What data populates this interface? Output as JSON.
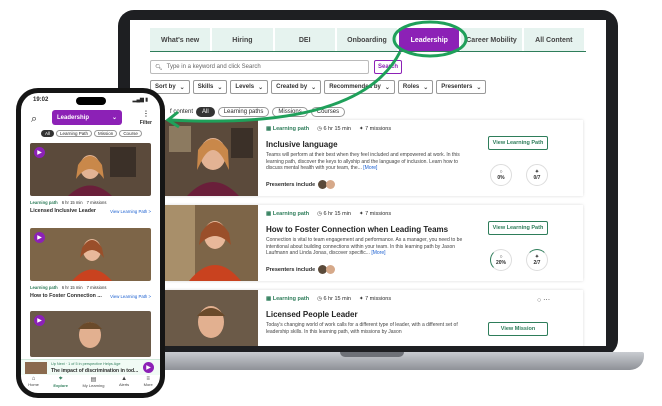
{
  "desktop": {
    "tabs": [
      {
        "label": "What's new"
      },
      {
        "label": "Hiring"
      },
      {
        "label": "DEI"
      },
      {
        "label": "Onboarding"
      },
      {
        "label": "Leadership"
      },
      {
        "label": "Career Mobility"
      },
      {
        "label": "All Content"
      }
    ],
    "search_placeholder": "Type in a keyword and click Search",
    "search_button": "Search",
    "filters": [
      "Sort by",
      "Skills",
      "Levels",
      "Created by",
      "Recommended by",
      "Roles",
      "Presenters"
    ],
    "content_type_label": "f content",
    "content_chips": [
      "All",
      "Learning paths",
      "Missions",
      "Courses"
    ],
    "cards": [
      {
        "type": "Learning path",
        "duration": "6 hr 15 min",
        "missions": "7 missions",
        "title": "Inclusive language",
        "desc": "Teams will perform at their best when they feel included and empowered at work. In this learning path, discover the keys to allyship and the language of inclusion. Learn how to discuss mental health with your team, the...",
        "more": "[More]",
        "presenters_label": "Presenters include",
        "button": "View Learning Path",
        "ring1": "0%",
        "ring2": "0/7"
      },
      {
        "type": "Learning path",
        "duration": "6 hr 15 min",
        "missions": "7 missions",
        "title": "How to Foster Connection when Leading Teams",
        "desc": "Connection is vital to team engagement and performance. As a manager, you need to be intentional about building connections within your team. In this learning path by Jason Laufmann and Linda Jonas, discover specific...",
        "more": "[More]",
        "presenters_label": "Presenters include",
        "button": "View Learning Path",
        "ring1": "20%",
        "ring2": "2/7"
      },
      {
        "type": "Learning path",
        "duration": "6 hr 15 min",
        "missions": "7 missions",
        "title": "Licensed People Leader",
        "desc": "Today's changing world of work calls for a different type of leader, with a different set of leadership skills. In this learning path, with missions by Jason",
        "more": "",
        "button": "View Mission"
      }
    ]
  },
  "phone": {
    "time": "19:02",
    "status": "▂▄▆ ▮",
    "category": "Leadership",
    "filter_label": "Filter",
    "chips": [
      "All",
      "Learning Path",
      "Mission",
      "Course"
    ],
    "cards": [
      {
        "type": "Learning path",
        "duration": "6 hr 15 min",
        "missions": "7 missions",
        "title": "Licensed Inclusive Leader",
        "view": "View Learning Path >"
      },
      {
        "type": "Learning path",
        "duration": "6 hr 15 min",
        "missions": "7 missions",
        "title": "How to Foster Connection ...",
        "view": "View Learning Path >"
      }
    ],
    "mini_player": {
      "subtitle": "Up Next · 1 of 5 in perspective Helps Age",
      "title": "The impact of discrimination in tod..."
    },
    "nav": [
      {
        "label": "Home",
        "icon": "home-icon"
      },
      {
        "label": "Explore",
        "icon": "explore-icon"
      },
      {
        "label": "My Learning",
        "icon": "book-icon"
      },
      {
        "label": "Alerts",
        "icon": "bell-icon"
      },
      {
        "label": "More",
        "icon": "menu-icon"
      }
    ]
  },
  "colors": {
    "accent": "#8c21b6",
    "green": "#2e7d5a",
    "link": "#1a5fd0"
  }
}
